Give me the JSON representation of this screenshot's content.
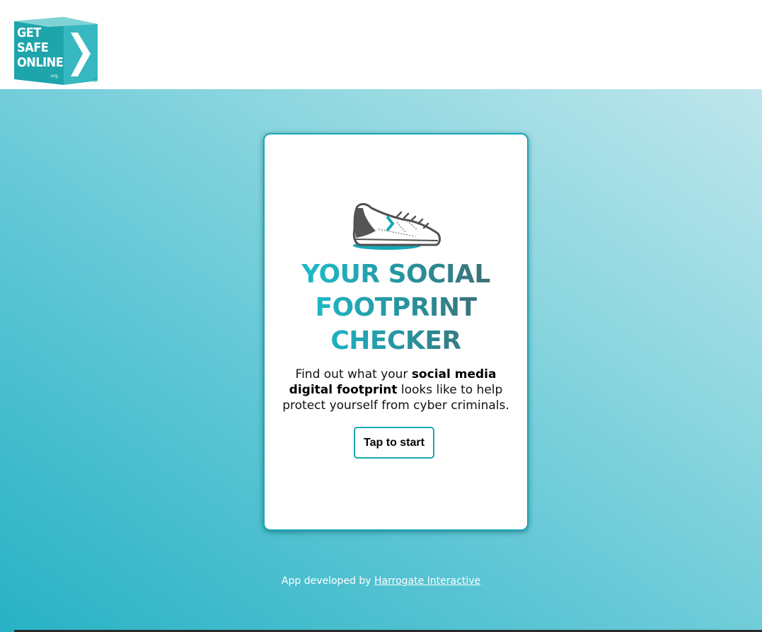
{
  "header": {
    "logo": {
      "line1": "GET",
      "line2": "SAFE",
      "line3": "ONLINE",
      "suffix": ".org",
      "registered": "®"
    }
  },
  "card": {
    "icon": "sneaker-icon",
    "title_line1": "YOUR SOCIAL",
    "title_line2": "FOOTPRINT",
    "title_line3": "CHECKER",
    "description": {
      "part1": "Find out what your ",
      "bold": "social media digital footprint",
      "part2": " looks like to help protect yourself from cyber criminals."
    },
    "start_button": "Tap to start"
  },
  "footer": {
    "prefix": "App developed by ",
    "link": "Harrogate Interactive"
  },
  "colors": {
    "brand_teal": "#17a7b5",
    "gradient_start": "#27b2c4",
    "gradient_end": "#bfe6ec"
  }
}
